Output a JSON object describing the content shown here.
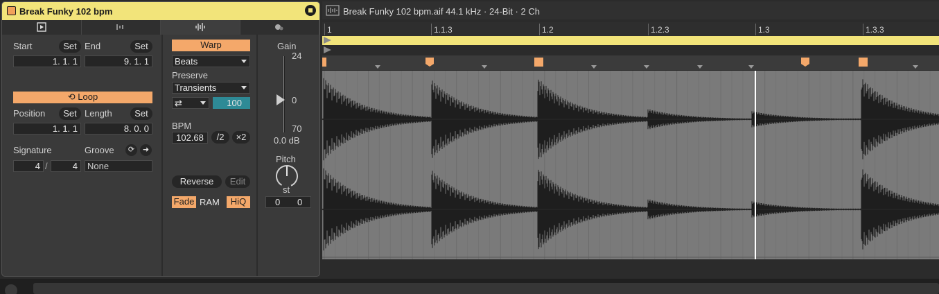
{
  "clip": {
    "name": "Break Funky 102 bpm",
    "tabs": [
      "clip-tab",
      "audio-tab",
      "envelopes-tab",
      "device-tab"
    ]
  },
  "clip_props": {
    "start_label": "Start",
    "set_label": "Set",
    "end_label": "End",
    "start_value": "1.   1.   1",
    "end_value": "9.   1.   1",
    "loop_label": "Loop",
    "position_label": "Position",
    "length_label": "Length",
    "position_value": "1.   1.   1",
    "length_value": "8.   0.   0",
    "signature_label": "Signature",
    "groove_label": "Groove",
    "sig_num": "4",
    "sig_den": "4",
    "sig_slash": "/",
    "groove_value": "None"
  },
  "warp": {
    "warp_label": "Warp",
    "mode": "Beats",
    "preserve_label": "Preserve",
    "preserve_value": "Transients",
    "loop_mode": "⇄",
    "envelope_value": "100",
    "bpm_label": "BPM",
    "bpm_value": "102.68",
    "half_label": "/2",
    "double_label": "×2",
    "reverse_label": "Reverse",
    "edit_label": "Edit",
    "fade_label": "Fade",
    "ram_label": "RAM",
    "hiq_label": "HiQ"
  },
  "gain": {
    "label": "Gain",
    "max": "24",
    "mid": "0",
    "min": "70",
    "value": "0.0 dB",
    "pitch_label": "Pitch",
    "unit": "st",
    "semitones": "0",
    "cents": "0"
  },
  "sample": {
    "title": "Break Funky 102 bpm.aif  44.1 kHz · 24-Bit · 2 Ch",
    "ruler": [
      "1",
      "1.1.3",
      "1.2",
      "1.2.3",
      "1.3",
      "1.3.3"
    ]
  },
  "colors": {
    "accent": "#f4a86a",
    "clip": "#f2e47a",
    "teal": "#2e8a96"
  }
}
